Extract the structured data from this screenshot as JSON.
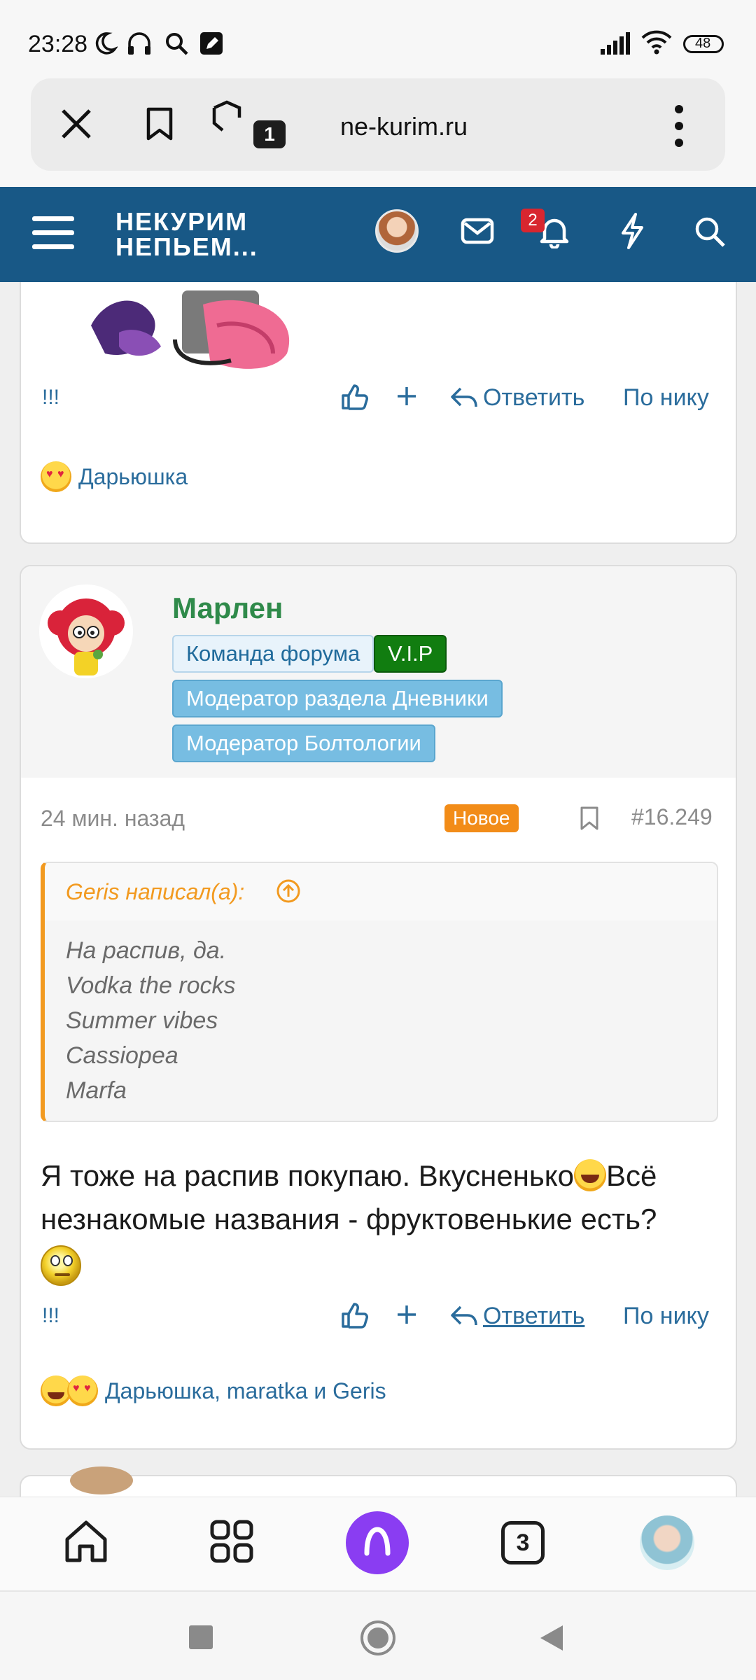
{
  "status_bar": {
    "time": "23:28",
    "icons": [
      "moon-icon",
      "headphones-icon",
      "search-icon",
      "edit-icon"
    ],
    "right_icons": [
      "signal-icon",
      "wifi-icon",
      "battery-icon"
    ],
    "battery": "48"
  },
  "browser": {
    "url": "ne-kurim.ru",
    "tab_count": "1",
    "icons": [
      "close-icon",
      "bookmark-icon",
      "tabs-icon",
      "more-icon"
    ]
  },
  "forum_header": {
    "logo_line1": "НЕКУРИМ",
    "logo_line2": "НЕПЬЕМ...",
    "notification_count": "2",
    "icons": [
      "menu-icon",
      "avatar",
      "mail-icon",
      "bell-icon",
      "lightning-icon",
      "search-icon"
    ]
  },
  "posts": {
    "top": {
      "actions": {
        "flag": "!!!",
        "reply": "Ответить",
        "by_nick": "По нику"
      },
      "reactions": {
        "users": "Дарьюшка"
      }
    },
    "main": {
      "username": "Марлен",
      "tags": {
        "team": "Команда форума",
        "vip": "V.I.P",
        "mod1": "Модератор раздела Дневники",
        "mod2": "Модератор Болтологии"
      },
      "meta": {
        "time": "24 мин. назад",
        "new_badge": "Новое",
        "number": "#16.249"
      },
      "quote": {
        "header": "Geris написал(а):",
        "lines": [
          "На распив, да.",
          "Vodka the rocks",
          "Summer vibes",
          "Cassiopea",
          "Marfa"
        ]
      },
      "text_part1": "Я тоже на распив покупаю. Вкусненько",
      "text_part2": "Всё незнакомые названия - фруктовенькие есть?",
      "actions": {
        "flag": "!!!",
        "reply": "Ответить",
        "by_nick": "По нику"
      },
      "reactions": {
        "users": "Дарьюшка, maratka и Geris"
      }
    }
  },
  "bottom_nav": {
    "tabs_count": "3",
    "icons": [
      "home-icon",
      "apps-icon",
      "alice-icon",
      "tabs-icon",
      "profile-avatar"
    ]
  },
  "colors": {
    "header_bg": "#185886",
    "link": "#2a6c9c",
    "username": "#2f8a4a",
    "quote_accent": "#f29a20",
    "new_badge": "#f28c18",
    "vip_tag": "#117d10",
    "mod_tag": "#77bde2"
  }
}
